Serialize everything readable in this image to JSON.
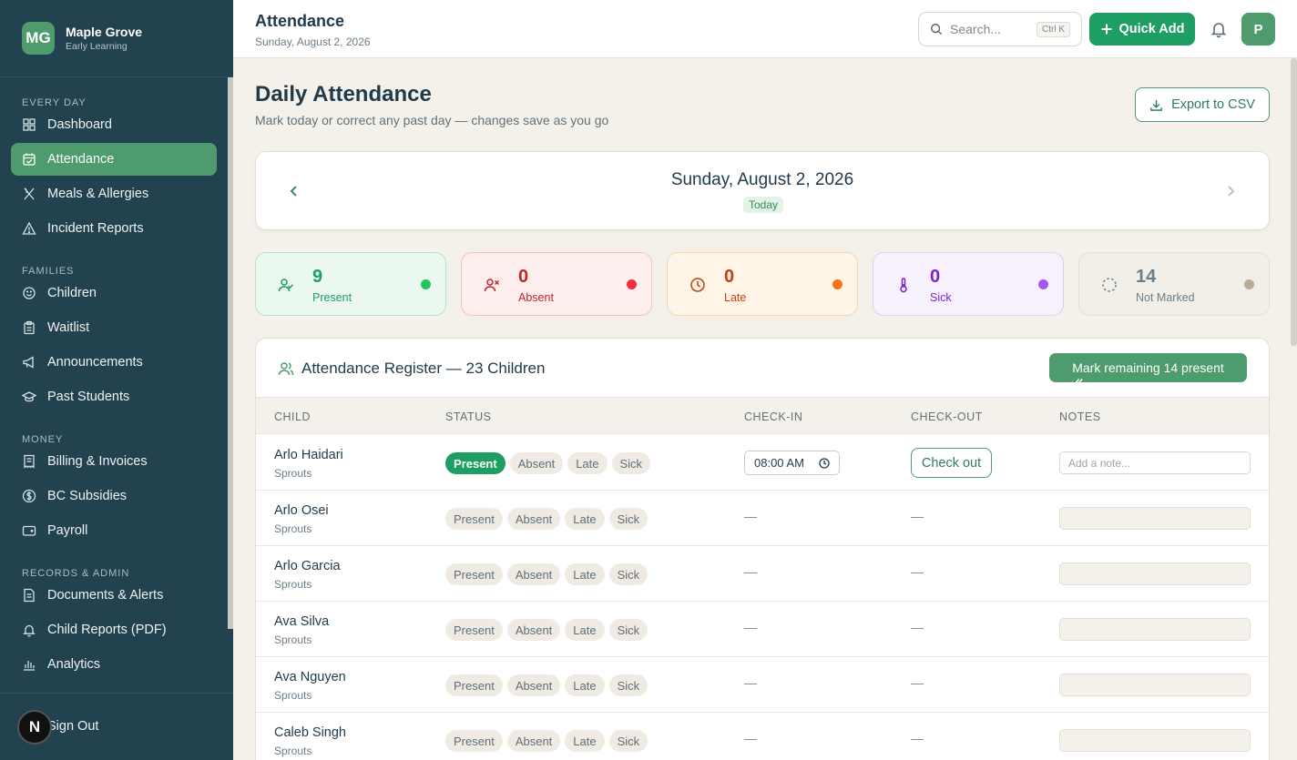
{
  "brand": {
    "initials": "MG",
    "name": "Maple Grove",
    "subtitle": "Early Learning"
  },
  "sidebar": {
    "sections": [
      {
        "label": "EVERY DAY",
        "items": [
          {
            "label": "Dashboard",
            "icon": "dashboard-icon"
          },
          {
            "label": "Attendance",
            "icon": "calendar-check-icon",
            "active": true
          },
          {
            "label": "Meals & Allergies",
            "icon": "utensils-icon"
          },
          {
            "label": "Incident Reports",
            "icon": "warning-icon"
          }
        ]
      },
      {
        "label": "FAMILIES",
        "items": [
          {
            "label": "Children",
            "icon": "smile-icon"
          },
          {
            "label": "Waitlist",
            "icon": "clipboard-icon"
          },
          {
            "label": "Announcements",
            "icon": "megaphone-icon"
          },
          {
            "label": "Past Students",
            "icon": "graduation-cap-icon"
          }
        ]
      },
      {
        "label": "MONEY",
        "items": [
          {
            "label": "Billing & Invoices",
            "icon": "receipt-icon"
          },
          {
            "label": "BC Subsidies",
            "icon": "dollar-circle-icon"
          },
          {
            "label": "Payroll",
            "icon": "wallet-icon"
          }
        ]
      },
      {
        "label": "RECORDS & ADMIN",
        "items": [
          {
            "label": "Documents & Alerts",
            "icon": "document-icon"
          },
          {
            "label": "Child Reports (PDF)",
            "icon": "bell-icon"
          },
          {
            "label": "Analytics",
            "icon": "bar-chart-icon"
          }
        ]
      }
    ],
    "signout_label": "Sign Out",
    "badge": "N"
  },
  "topbar": {
    "title": "Attendance",
    "date": "Sunday, August 2, 2026",
    "search_placeholder": "Search...",
    "search_shortcut": "Ctrl K",
    "quick_add": "Quick Add",
    "avatar": "P"
  },
  "page": {
    "title": "Daily Attendance",
    "subtitle": "Mark today or correct any past day — changes save as you go",
    "export_label": "Export to CSV",
    "current_date": "Sunday, August 2, 2026",
    "today_badge": "Today"
  },
  "stats": [
    {
      "value": "9",
      "label": "Present",
      "color": "#1e9e62",
      "dot": "#22c55e",
      "bg": "#ebf8ef",
      "border": "#b6e3c5"
    },
    {
      "value": "0",
      "label": "Absent",
      "color": "#c0262d",
      "dot": "#ef2f3a",
      "bg": "#fdeeee",
      "border": "#f3c4c4"
    },
    {
      "value": "0",
      "label": "Late",
      "color": "#c2410c",
      "dot": "#f97316",
      "bg": "#fef4e8",
      "border": "#f8d6ad"
    },
    {
      "value": "0",
      "label": "Sick",
      "color": "#7e22ce",
      "dot": "#a855f7",
      "bg": "#f7f0fd",
      "border": "#e2cdf5"
    },
    {
      "value": "14",
      "label": "Not Marked",
      "color": "#6b7d86",
      "dot": "#b8ad9a",
      "bg": "#f2efe8",
      "border": "#e3dfd5"
    }
  ],
  "register": {
    "title": "Attendance Register — 23 Children",
    "mark_all": "Mark remaining 14 present",
    "columns": [
      "CHILD",
      "STATUS",
      "CHECK-IN",
      "CHECK-OUT",
      "NOTES"
    ],
    "status_options": [
      "Present",
      "Absent",
      "Late",
      "Sick"
    ],
    "check_out_label": "Check out",
    "note_placeholder": "Add a note...",
    "empty": "—",
    "rows": [
      {
        "name": "Arlo Haidari",
        "group": "Sprouts",
        "status": "Present",
        "check_in": "08:00 AM"
      },
      {
        "name": "Arlo Osei",
        "group": "Sprouts",
        "status": "",
        "check_in": ""
      },
      {
        "name": "Arlo Garcia",
        "group": "Sprouts",
        "status": "",
        "check_in": ""
      },
      {
        "name": "Ava Silva",
        "group": "Sprouts",
        "status": "",
        "check_in": ""
      },
      {
        "name": "Ava Nguyen",
        "group": "Sprouts",
        "status": "",
        "check_in": ""
      },
      {
        "name": "Caleb Singh",
        "group": "Sprouts",
        "status": "",
        "check_in": ""
      }
    ]
  }
}
